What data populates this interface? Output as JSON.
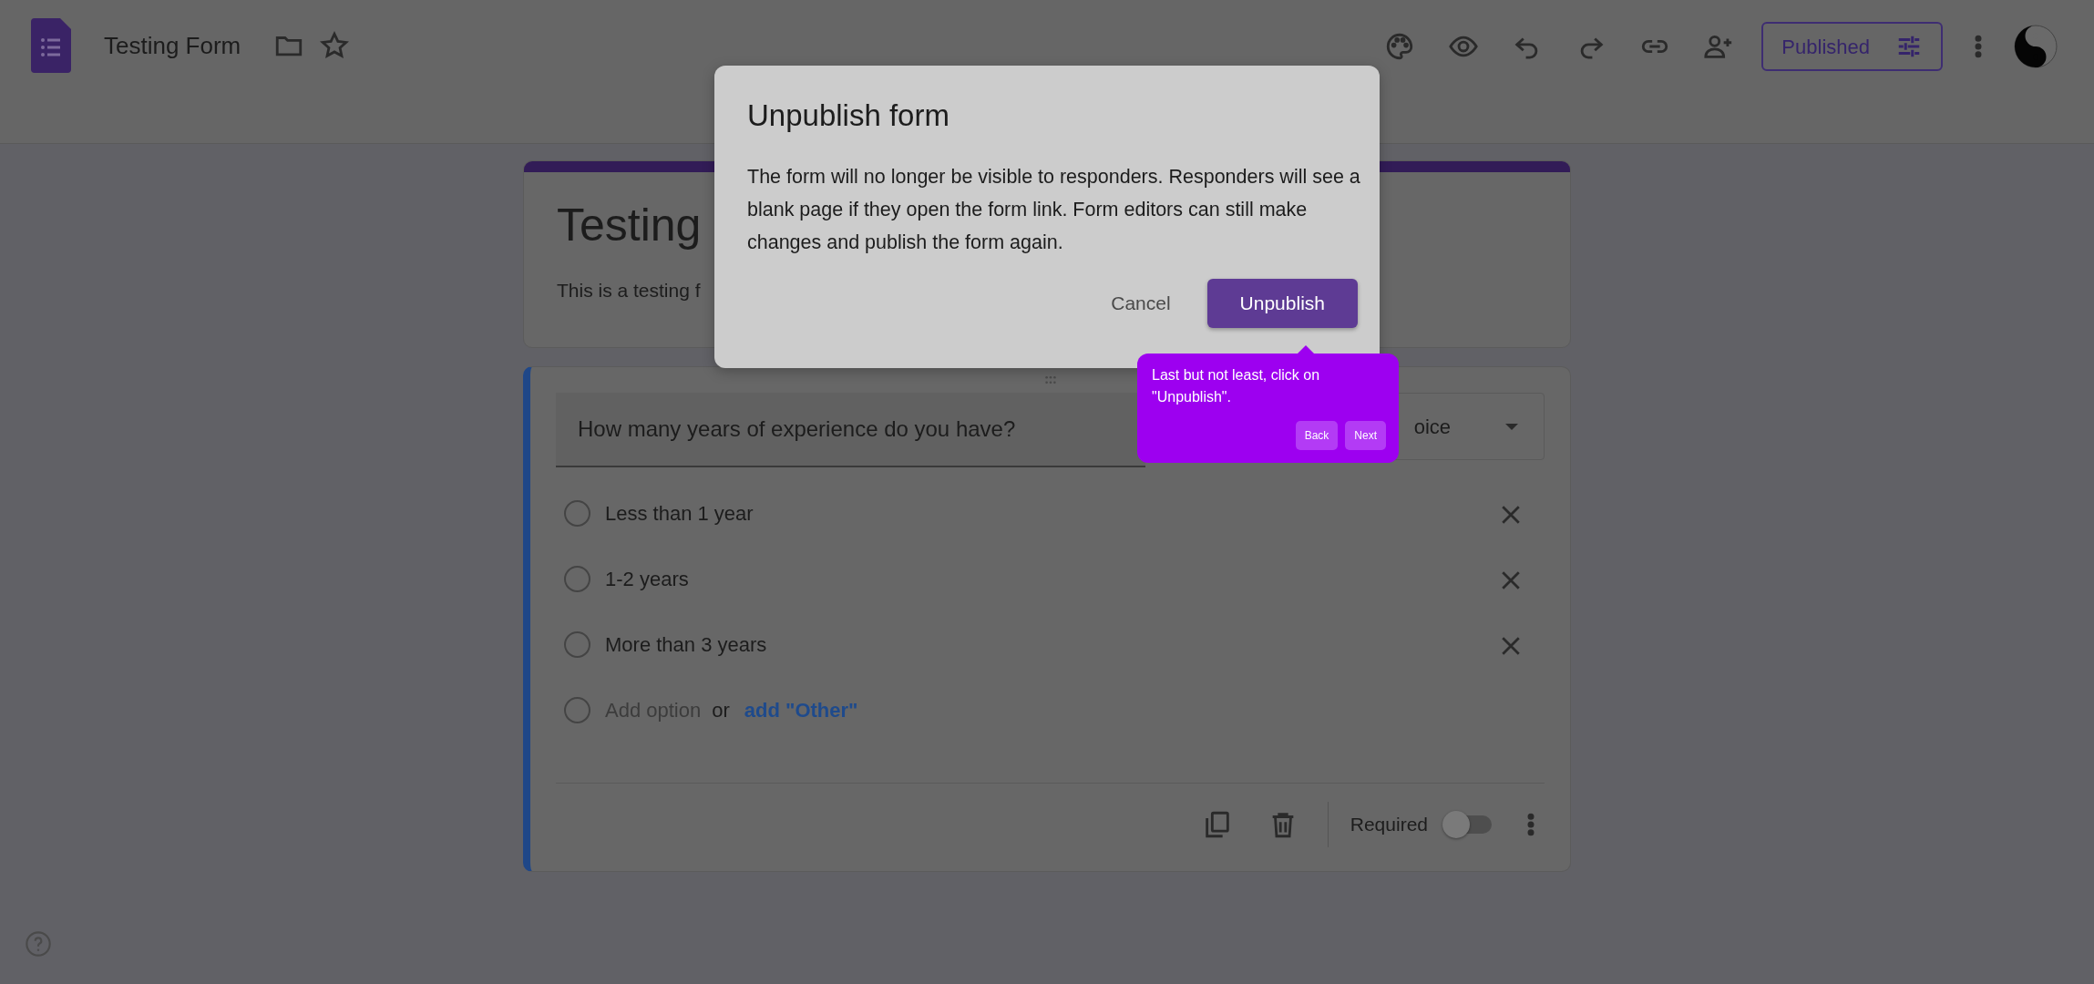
{
  "header": {
    "title": "Testing Form",
    "publish_button": "Published"
  },
  "form_header": {
    "title": "Testing",
    "description": "This is a testing f"
  },
  "question": {
    "title": "How many years of experience do you have?",
    "type_visible": "oice",
    "options": [
      {
        "kind": "option",
        "label": "Less than 1 year",
        "selected": false
      },
      {
        "kind": "option",
        "label": "1-2 years",
        "selected": false
      },
      {
        "kind": "option",
        "label": "More than 3 years",
        "selected": false
      },
      {
        "kind": "add",
        "label": "Add option",
        "or": "or",
        "add_other": "add \"Other\"",
        "selected": false
      }
    ],
    "required_label": "Required",
    "required": false
  },
  "dialog": {
    "title": "Unpublish form",
    "body": "The form will no longer be visible to responders. Responders will see a blank page if they open the form link. Form editors can still make changes and publish the form again.",
    "buttons": [
      {
        "label": "Cancel",
        "kind": "text"
      },
      {
        "label": "Unpublish",
        "kind": "filled"
      }
    ]
  },
  "tour_tip": {
    "text": "Last but not least, click on \"Unpublish\".",
    "buttons": [
      "Back",
      "Next"
    ]
  }
}
